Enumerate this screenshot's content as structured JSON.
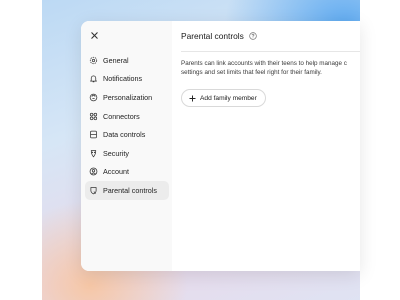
{
  "sidebar": {
    "items": [
      {
        "label": "General",
        "icon": "gear-icon"
      },
      {
        "label": "Notifications",
        "icon": "bell-icon"
      },
      {
        "label": "Personalization",
        "icon": "personalization-icon"
      },
      {
        "label": "Connectors",
        "icon": "connectors-icon"
      },
      {
        "label": "Data controls",
        "icon": "database-icon"
      },
      {
        "label": "Security",
        "icon": "shield-icon"
      },
      {
        "label": "Account",
        "icon": "user-circle-icon"
      },
      {
        "label": "Parental controls",
        "icon": "parental-shield-icon"
      }
    ],
    "active_index": 7
  },
  "main": {
    "title": "Parental controls",
    "description_line1": "Parents can link accounts with their teens to help manage c",
    "description_line2": "settings and set limits that feel right for their family.",
    "add_button_label": "Add family member"
  },
  "colors": {
    "sidebar_bg": "#f9f9f9",
    "active_item_bg": "#ececec",
    "text": "#1f1f1f"
  }
}
